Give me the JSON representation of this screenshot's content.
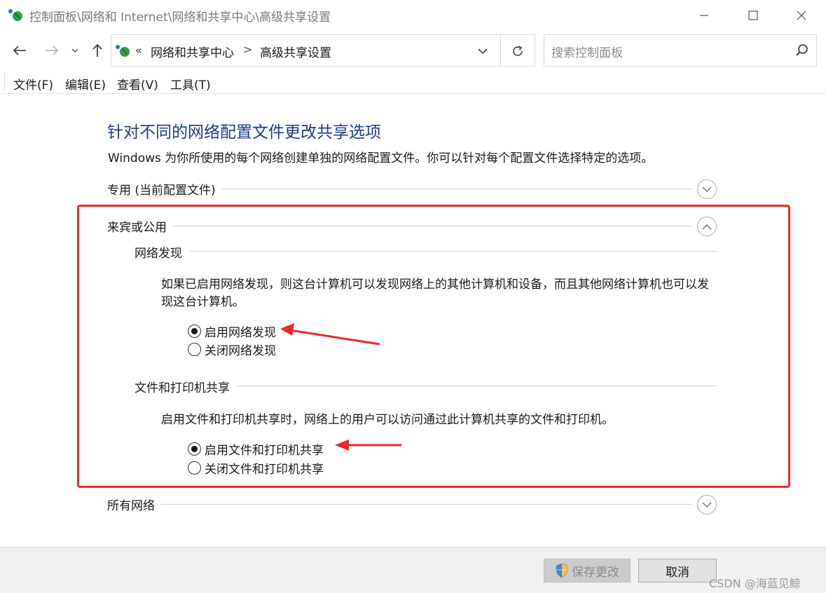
{
  "window": {
    "title": "控制面板\\网络和 Internet\\网络和共享中心\\高级共享设置",
    "icon": "network-center-icon"
  },
  "address": {
    "chevron": "«",
    "crumbs": [
      "网络和共享中心",
      "高级共享设置"
    ],
    "separator": ">"
  },
  "search": {
    "placeholder": "搜索控制面板"
  },
  "menu": [
    "文件(F)",
    "编辑(E)",
    "查看(V)",
    "工具(T)"
  ],
  "content": {
    "heading": "针对不同的网络配置文件更改共享选项",
    "intro": "Windows 为你所使用的每个网络创建单独的网络配置文件。你可以针对每个配置文件选择特定的选项。",
    "profiles": [
      {
        "label": "专用 (当前配置文件)",
        "expanded": false
      },
      {
        "label": "来宾或公用",
        "expanded": true
      },
      {
        "label": "所有网络",
        "expanded": false
      }
    ],
    "network_discovery": {
      "title": "网络发现",
      "description": "如果已启用网络发现，则这台计算机可以发现网络上的其他计算机和设备，而且其他网络计算机也可以发现这台计算机。",
      "options": [
        {
          "label": "启用网络发现",
          "selected": true
        },
        {
          "label": "关闭网络发现",
          "selected": false
        }
      ]
    },
    "file_printer_sharing": {
      "title": "文件和打印机共享",
      "description": "启用文件和打印机共享时，网络上的用户可以访问通过此计算机共享的文件和打印机。",
      "options": [
        {
          "label": "启用文件和打印机共享",
          "selected": true
        },
        {
          "label": "关闭文件和打印机共享",
          "selected": false
        }
      ]
    }
  },
  "footer": {
    "save_label": "保存更改",
    "cancel_label": "取消",
    "watermark": "CSDN @海蓝见鲸"
  },
  "colors": {
    "heading": "#1e3a8a",
    "annotation": "#ea2a2a"
  }
}
